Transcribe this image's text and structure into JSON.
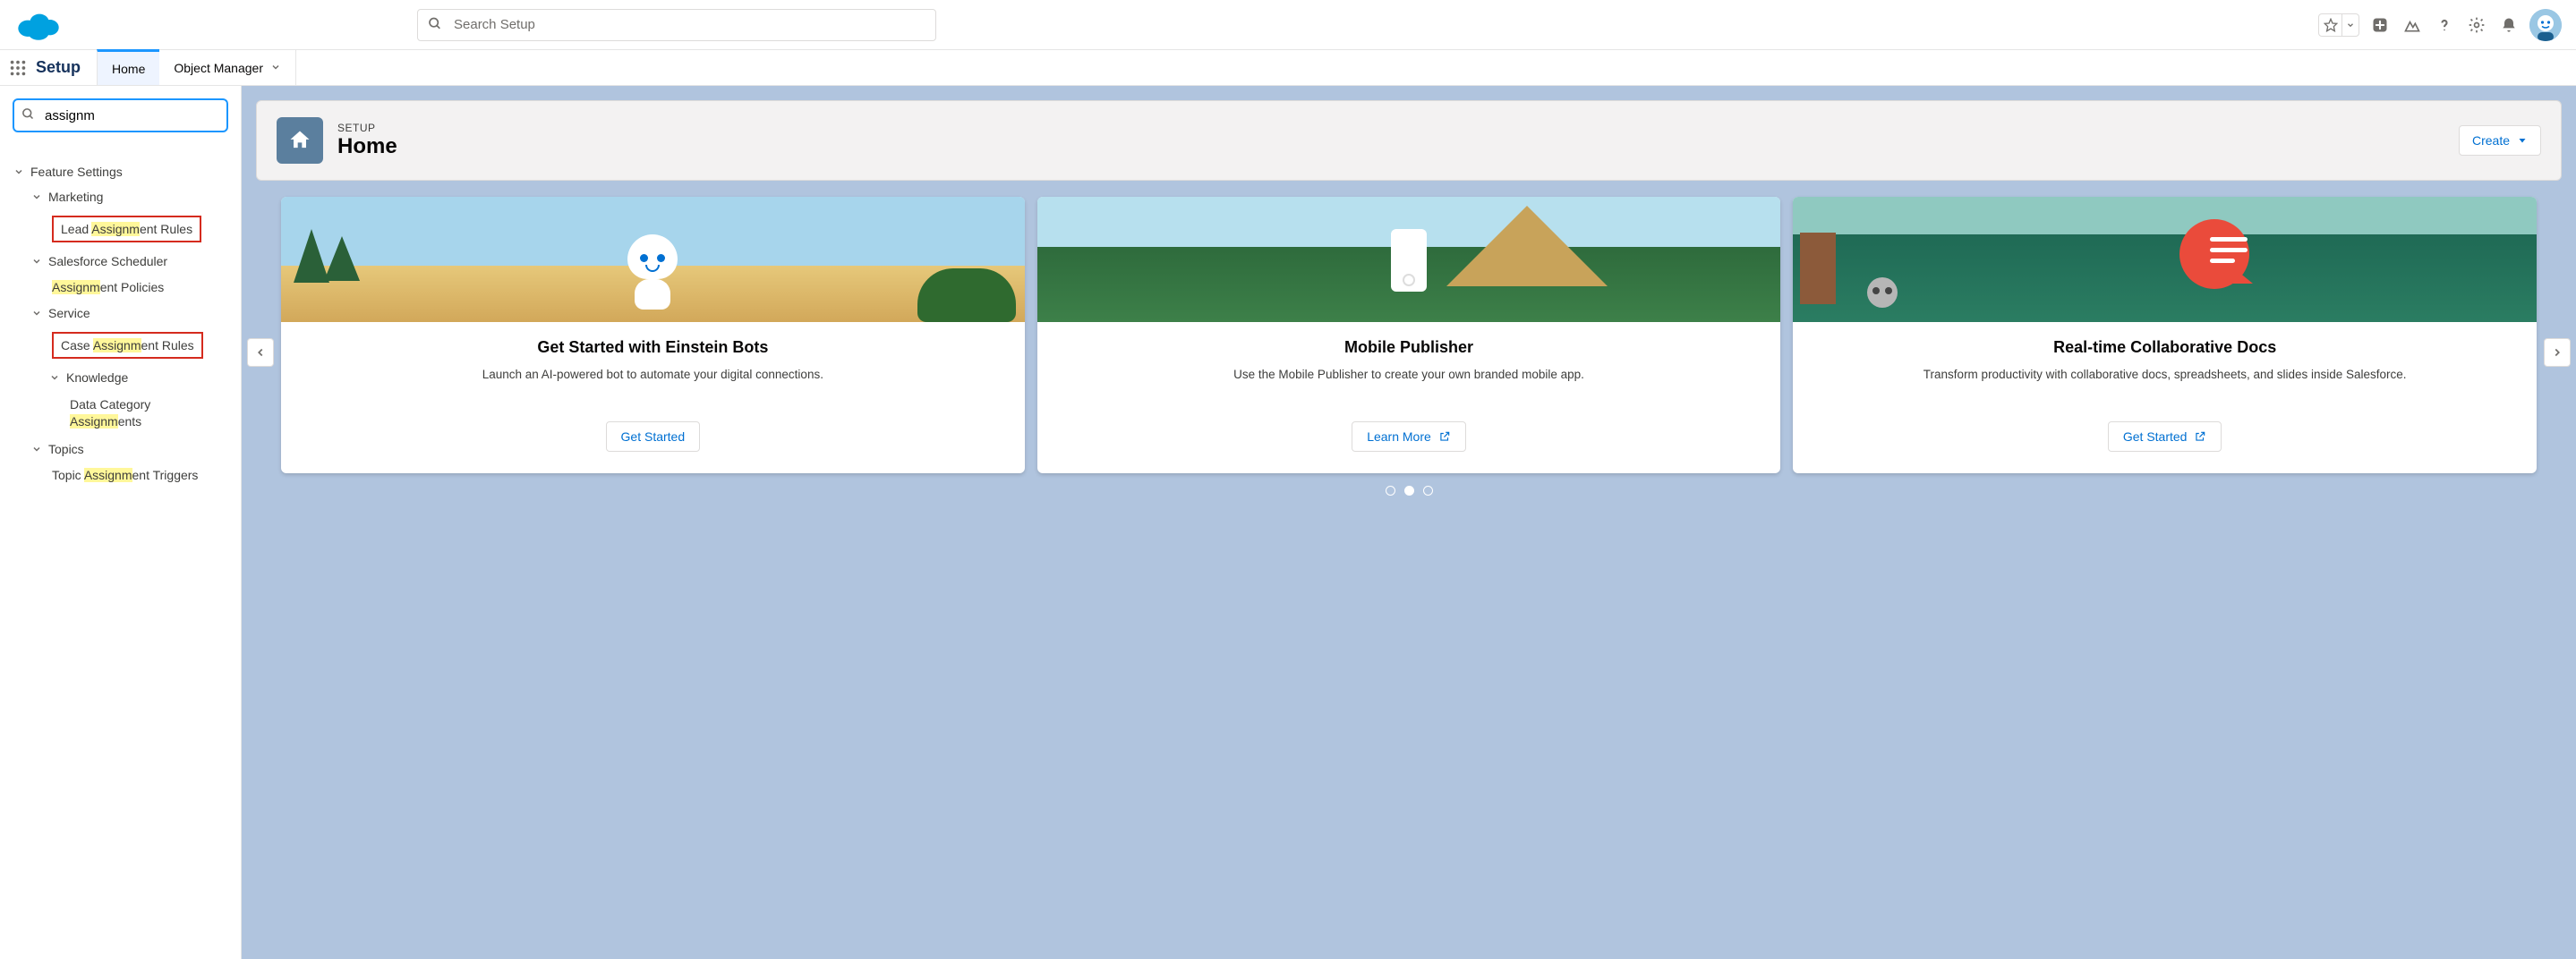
{
  "global_search_placeholder": "Search Setup",
  "app_title": "Setup",
  "tabs": {
    "home": "Home",
    "object_manager": "Object Manager"
  },
  "quick_find_value": "assignm",
  "tree": {
    "feature_settings": "Feature Settings",
    "marketing": "Marketing",
    "lead_assignment_pre": "Lead ",
    "lead_assignment_hl": "Assignm",
    "lead_assignment_post": "ent Rules",
    "salesforce_scheduler": "Salesforce Scheduler",
    "assignment_policies_hl": "Assignm",
    "assignment_policies_post": "ent Policies",
    "service": "Service",
    "case_assignment_pre": "Case ",
    "case_assignment_hl": "Assignm",
    "case_assignment_post": "ent Rules",
    "knowledge": "Knowledge",
    "data_category_line1": "Data Category",
    "data_category_hl": "Assignm",
    "data_category_post": "ents",
    "topics": "Topics",
    "topic_triggers_pre": "Topic ",
    "topic_triggers_hl": "Assignm",
    "topic_triggers_post": "ent Triggers"
  },
  "page_header": {
    "eyebrow": "SETUP",
    "title": "Home",
    "create_label": "Create"
  },
  "cards": [
    {
      "title": "Get Started with Einstein Bots",
      "desc": "Launch an AI-powered bot to automate your digital connections.",
      "cta": "Get Started",
      "has_ext_icon": false
    },
    {
      "title": "Mobile Publisher",
      "desc": "Use the Mobile Publisher to create your own branded mobile app.",
      "cta": "Learn More",
      "has_ext_icon": true
    },
    {
      "title": "Real-time Collaborative Docs",
      "desc": "Transform productivity with collaborative docs, spreadsheets, and slides inside Salesforce.",
      "cta": "Get Started",
      "has_ext_icon": true
    }
  ]
}
